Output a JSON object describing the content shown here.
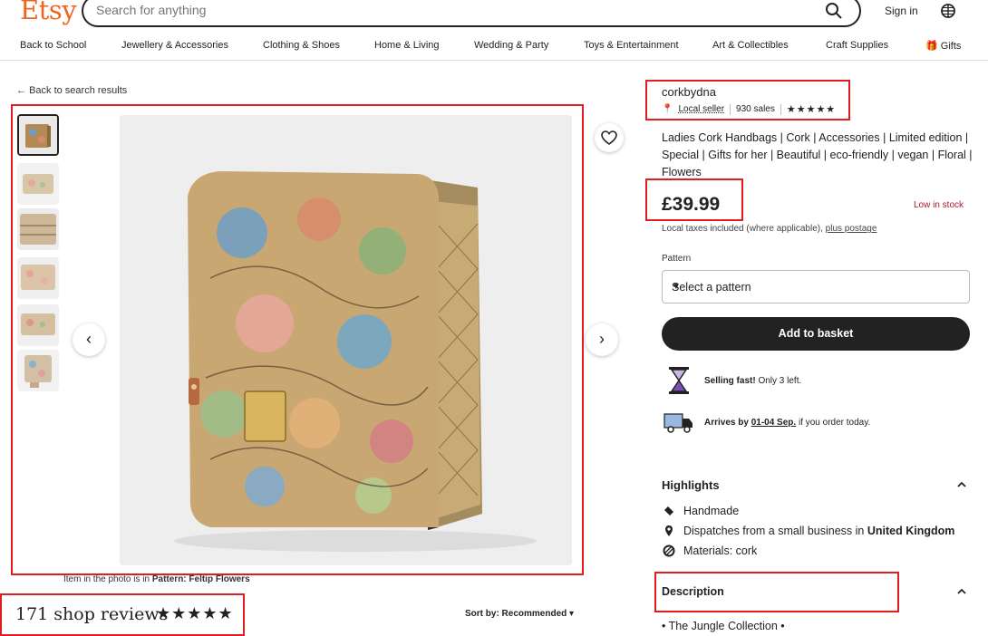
{
  "header": {
    "logo": "Etsy",
    "search_placeholder": "Search for anything",
    "sign_in": "Sign in",
    "categories": [
      "Back to School",
      "Jewellery & Accessories",
      "Clothing & Shoes",
      "Home & Living",
      "Wedding & Party",
      "Toys & Entertainment",
      "Art & Collectibles",
      "Craft Supplies",
      "Gifts"
    ]
  },
  "listing": {
    "back_link": "Back to search results",
    "caption_prefix": "Item in the photo is in",
    "caption_pattern": "Pattern: Feltip Flowers",
    "shop_reviews": "171 shop reviews",
    "review_stars": "★★★★★",
    "sort": "Sort by: Recommended"
  },
  "seller": {
    "name": "corkbydna",
    "local": "Local seller",
    "sales": "930 sales",
    "stars": "★★★★★"
  },
  "product": {
    "title": "Ladies Cork Handbags | Cork | Accessories | Limited edition | Special | Gifts for her | Beautiful | eco-friendly | vegan | Floral | Flowers",
    "price": "£39.99",
    "stock": "Low in stock",
    "tax_text": "Local taxes included (where applicable),",
    "tax_link": "plus postage",
    "pattern_label": "Pattern",
    "pattern_select": "Select a pattern",
    "add_to_basket": "Add to basket",
    "selling_bold": "Selling fast!",
    "selling_rest": "Only 3 left.",
    "arrives_bold": "Arrives by",
    "arrives_date": "01-04 Sep.",
    "arrives_rest": "if you order today."
  },
  "highlights": {
    "title": "Highlights",
    "handmade": "Handmade",
    "dispatch_text": "Dispatches from a small business in",
    "dispatch_country": "United Kingdom",
    "materials": "Materials: cork"
  },
  "description": {
    "title": "Description",
    "first_line": "• The Jungle Collection •"
  },
  "colors": {
    "brand": "#f1641e",
    "highlight_box": "#e01e1e",
    "low_stock": "#a61a2e"
  }
}
